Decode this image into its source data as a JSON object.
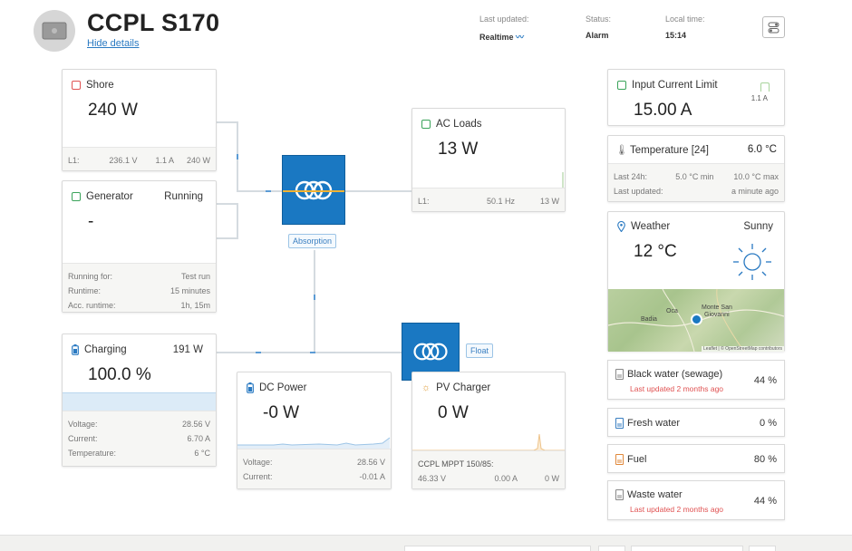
{
  "header": {
    "device_name": "CCPL S170",
    "hide_details": "Hide details",
    "last_updated_label": "Last updated:",
    "last_updated_value": "Realtime",
    "status_label": "Status:",
    "status_value": "Alarm",
    "local_time_label": "Local time:",
    "local_time_value": "15:14"
  },
  "shore": {
    "title": "Shore",
    "value": "240 W",
    "phase": "L1:",
    "voltage": "236.1 V",
    "current": "1.1 A",
    "power": "240 W"
  },
  "generator": {
    "title": "Generator",
    "state": "Running",
    "value": "-",
    "running_for_label": "Running for:",
    "running_for_value": "Test run",
    "runtime_label": "Runtime:",
    "runtime_value": "15 minutes",
    "acc_runtime_label": "Acc. runtime:",
    "acc_runtime_value": "1h, 15m"
  },
  "inverter": {
    "state": "Absorption"
  },
  "charger_unit": {
    "state": "Float"
  },
  "ac_loads": {
    "title": "AC Loads",
    "value": "13 W",
    "phase": "L1:",
    "frequency": "50.1 Hz",
    "power": "13 W"
  },
  "battery": {
    "title": "Charging",
    "power": "191 W",
    "soc": "100.0 %",
    "soc_fraction": 1.0,
    "voltage_label": "Voltage:",
    "voltage_value": "28.56 V",
    "current_label": "Current:",
    "current_value": "6.70 A",
    "temp_label": "Temperature:",
    "temp_value": "6 °C"
  },
  "dc_power": {
    "title": "DC Power",
    "value": "-0 W",
    "voltage_label": "Voltage:",
    "voltage_value": "28.56 V",
    "current_label": "Current:",
    "current_value": "-0.01 A"
  },
  "pv_charger": {
    "title": "PV Charger",
    "value": "0 W",
    "device": "CCPL MPPT 150/85:",
    "voltage": "46.33 V",
    "current": "0.00 A",
    "power": "0 W"
  },
  "input_current_limit": {
    "title": "Input Current Limit",
    "value": "15.00 A",
    "small_value": "1.1 A"
  },
  "temperature": {
    "title": "Temperature [24]",
    "value": "6.0 °C",
    "last24_label": "Last 24h:",
    "min": "5.0 °C min",
    "max": "10.0 °C max",
    "last_updated_label": "Last updated:",
    "last_updated_value": "a minute ago"
  },
  "weather": {
    "title": "Weather",
    "condition": "Sunny",
    "temp": "12 °C",
    "map_labels": {
      "badia": "Badia",
      "oca": "Oca",
      "monte": "Monte San",
      "giovanni": "Giovanni"
    },
    "attribution": "Leaflet | © OpenStreetMap contributors"
  },
  "tanks": [
    {
      "name": "Black water (sewage)",
      "pct": "44 %",
      "warning": "Last updated 2 months ago",
      "color": "#888888"
    },
    {
      "name": "Fresh water",
      "pct": "0 %",
      "warning": "",
      "color": "#3a7fc1"
    },
    {
      "name": "Fuel",
      "pct": "80 %",
      "warning": "",
      "color": "#e0883a"
    },
    {
      "name": "Waste water",
      "pct": "44 %",
      "warning": "Last updated 2 months ago",
      "color": "#888888"
    }
  ],
  "colors": {
    "accent_blue": "#1a78c2",
    "alarm_red": "#e05252",
    "shore_icon": "#e05252",
    "generator_icon": "#3aa35a",
    "ac_loads_icon": "#3aa35a"
  }
}
